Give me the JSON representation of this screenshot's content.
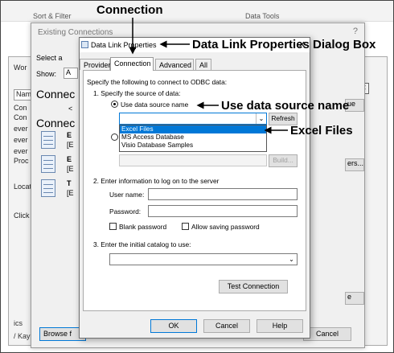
{
  "ribbon": {
    "sort_filter": "Sort & Filter",
    "data_tools": "Data Tools"
  },
  "workbook": {
    "title": "Wor",
    "rows": [
      "Nam",
      "Con",
      "Con",
      "ever",
      "ever",
      "ever",
      "Proc"
    ],
    "location": "Locati",
    "click": "Click",
    "bottom_tab": "ics",
    "bottom_tab2": "/ Kay"
  },
  "existing": {
    "title": "Existing Connections",
    "close": "?",
    "select_label": "Select a",
    "show_label": "Show:",
    "show_value": "A",
    "section1": "Connec",
    "section2": "Connec",
    "items": [
      {
        "line1": "E",
        "line2": "[E"
      },
      {
        "line1": "E",
        "line2": "[E"
      },
      {
        "line1": "T",
        "line2": "[E"
      }
    ],
    "browse_button": "Browse f",
    "cancel_button": "Cancel",
    "right_btn_1": "ue",
    "right_btn_2": "ers...",
    "right_btn_3": "e",
    "marker_a": "<",
    "marker_b": "<"
  },
  "dialog": {
    "title": "Data Link Properties",
    "close": "✕",
    "tabs": [
      "Provider",
      "Connection",
      "Advanced",
      "All"
    ],
    "intro": "Specify the following to connect to ODBC data:",
    "step1": "1. Specify the source of data:",
    "use_dsn": "Use data source name",
    "refresh_button": "Refresh",
    "dropdown_options": [
      "Excel Files",
      "MS Access Database",
      "Visio Database Samples"
    ],
    "build_button": "Build...",
    "step2": "2. Enter information to log on to the server",
    "username_label": "User name:",
    "password_label": "Password:",
    "blank_password": "Blank password",
    "allow_saving": "Allow saving password",
    "step3": "3. Enter the initial catalog to use:",
    "test_button": "Test Connection",
    "ok_button": "OK",
    "cancel_button": "Cancel",
    "help_button": "Help"
  },
  "annotations": {
    "connection": "Connection",
    "dialog_box": "Data Link Properties Dialog Box",
    "use_dsn": "Use data source name",
    "excel_files": "Excel Files"
  }
}
